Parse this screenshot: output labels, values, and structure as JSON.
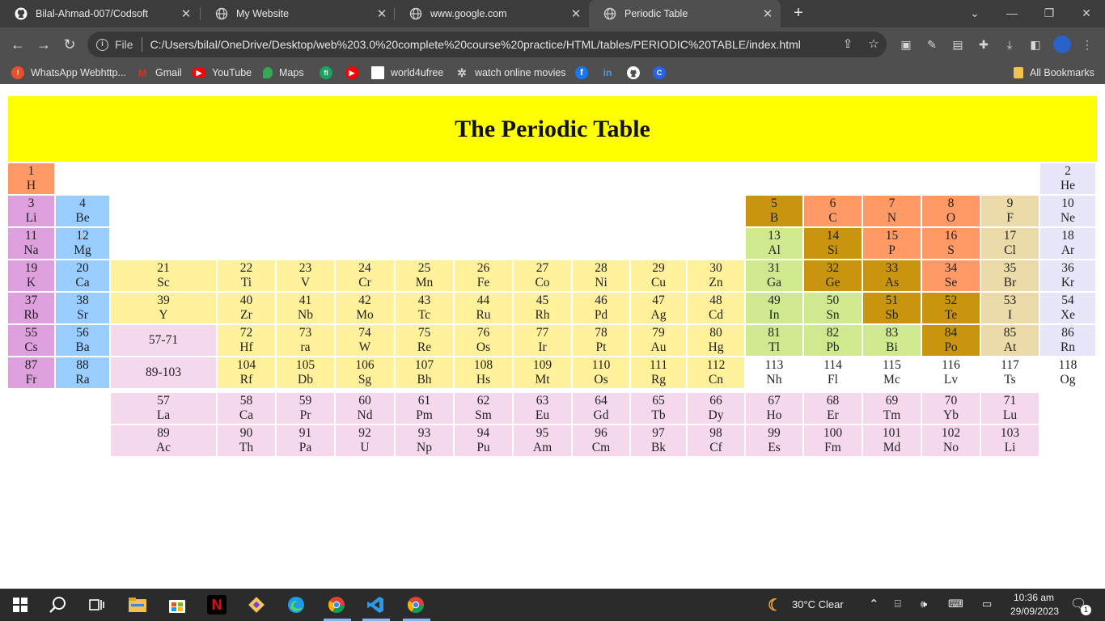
{
  "browser": {
    "tabs": [
      {
        "label": "Bilal-Ahmad-007/Codsoft",
        "icon": "github-icon",
        "active": false
      },
      {
        "label": "My Website",
        "icon": "globe-icon",
        "active": false
      },
      {
        "label": "www.google.com",
        "icon": "globe-icon",
        "active": false
      },
      {
        "label": "Periodic Table",
        "icon": "globe-icon",
        "active": true
      }
    ],
    "new_tab_label": "+",
    "address_scheme": "File",
    "url": "C:/Users/bilal/OneDrive/Desktop/web%203.0%20complete%20course%20practice/HTML/tables/PERIODIC%20TABLE/index.html",
    "bookmarks": [
      {
        "label": "WhatsApp Webhttp...",
        "icon": "whatsapp-icon",
        "color": "#e8502b"
      },
      {
        "label": "Gmail",
        "icon": "gmail-icon",
        "color": "#d93025"
      },
      {
        "label": "YouTube",
        "icon": "youtube-icon",
        "color": "#ff0000"
      },
      {
        "label": "Maps",
        "icon": "maps-icon",
        "color": "#34a853"
      },
      {
        "label": "",
        "icon": "fi-icon",
        "color": "#1aa260"
      },
      {
        "label": "",
        "icon": "red-play-icon",
        "color": "#ff0000"
      },
      {
        "label": "world4ufree",
        "icon": "page-icon",
        "color": "#ffffff"
      },
      {
        "label": "watch online movies",
        "icon": "film-icon",
        "color": "#888888"
      },
      {
        "label": "",
        "icon": "facebook-icon",
        "color": "#1877f2"
      },
      {
        "label": "",
        "icon": "linkedin-icon",
        "color": "#0a66c2"
      },
      {
        "label": "",
        "icon": "github-icon",
        "color": "#ffffff"
      },
      {
        "label": "",
        "icon": "c-logo-icon",
        "color": "#2563eb"
      }
    ],
    "all_bookmarks_label": "All Bookmarks"
  },
  "page": {
    "title": "The Periodic Table",
    "colors": {
      "title_bg": "#ffff00",
      "alkali": "#dda0dd",
      "alkaline_earth": "#99ccff",
      "transition": "#fff09a",
      "f_block": "#f5d8ec",
      "poor_metal": "#cfe98f",
      "metalloid": "#c9940f",
      "nonmetal": "#ff9966",
      "halogen": "#ecdaa8",
      "noble_gas": "#e6e6f8",
      "unknown": "#ffffff"
    },
    "rows": [
      [
        {
          "num": "1",
          "sym": "H",
          "type": "nonmetal",
          "col": 0
        }
      ],
      [
        {
          "num": "3",
          "sym": "Li",
          "type": "alkali",
          "col": 0
        },
        {
          "num": "4",
          "sym": "Be",
          "type": "alkaline_earth",
          "col": 1
        }
      ],
      [
        {
          "num": "11",
          "sym": "Na",
          "type": "alkali",
          "col": 0
        },
        {
          "num": "12",
          "sym": "Mg",
          "type": "alkaline_earth",
          "col": 1
        }
      ],
      [
        {
          "num": "19",
          "sym": "K",
          "type": "alkali",
          "col": 0
        },
        {
          "num": "20",
          "sym": "Ca",
          "type": "alkaline_earth",
          "col": 1
        },
        {
          "num": "21",
          "sym": "Sc",
          "type": "transition",
          "col": 2
        },
        {
          "num": "22",
          "sym": "Ti",
          "type": "transition",
          "col": 3
        },
        {
          "num": "23",
          "sym": "V",
          "type": "transition",
          "col": 4
        },
        {
          "num": "24",
          "sym": "Cr",
          "type": "transition",
          "col": 5
        },
        {
          "num": "25",
          "sym": "Mn",
          "type": "transition",
          "col": 6
        },
        {
          "num": "26",
          "sym": "Fe",
          "type": "transition",
          "col": 7
        },
        {
          "num": "27",
          "sym": "Co",
          "type": "transition",
          "col": 8
        },
        {
          "num": "28",
          "sym": "Ni",
          "type": "transition",
          "col": 9
        },
        {
          "num": "29",
          "sym": "Cu",
          "type": "transition",
          "col": 10
        },
        {
          "num": "30",
          "sym": "Zn",
          "type": "transition",
          "col": 11
        },
        {
          "num": "31",
          "sym": "Ga",
          "type": "poor_metal",
          "col": 12
        },
        {
          "num": "32",
          "sym": "Ge",
          "type": "metalloid",
          "col": 13
        },
        {
          "num": "33",
          "sym": "As",
          "type": "metalloid",
          "col": 14
        },
        {
          "num": "34",
          "sym": "Se",
          "type": "nonmetal",
          "col": 15
        },
        {
          "num": "35",
          "sym": "Br",
          "type": "halogen",
          "col": 16
        },
        {
          "num": "36",
          "sym": "Kr",
          "type": "noble_gas",
          "col": 17
        }
      ],
      [
        {
          "num": "37",
          "sym": "Rb",
          "type": "alkali",
          "col": 0
        },
        {
          "num": "38",
          "sym": "Sr",
          "type": "alkaline_earth",
          "col": 1
        },
        {
          "num": "39",
          "sym": "Y",
          "type": "transition",
          "col": 2
        },
        {
          "num": "40",
          "sym": "Zr",
          "type": "transition",
          "col": 3
        },
        {
          "num": "41",
          "sym": "Nb",
          "type": "transition",
          "col": 4
        },
        {
          "num": "42",
          "sym": "Mo",
          "type": "transition",
          "col": 5
        },
        {
          "num": "43",
          "sym": "Tc",
          "type": "transition",
          "col": 6
        },
        {
          "num": "44",
          "sym": "Ru",
          "type": "transition",
          "col": 7
        },
        {
          "num": "45",
          "sym": "Rh",
          "type": "transition",
          "col": 8
        },
        {
          "num": "46",
          "sym": "Pd",
          "type": "transition",
          "col": 9
        },
        {
          "num": "47",
          "sym": "Ag",
          "type": "transition",
          "col": 10
        },
        {
          "num": "48",
          "sym": "Cd",
          "type": "transition",
          "col": 11
        },
        {
          "num": "49",
          "sym": "In",
          "type": "poor_metal",
          "col": 12
        },
        {
          "num": "50",
          "sym": "Sn",
          "type": "poor_metal",
          "col": 13
        },
        {
          "num": "51",
          "sym": "Sb",
          "type": "metalloid",
          "col": 14
        },
        {
          "num": "52",
          "sym": "Te",
          "type": "metalloid",
          "col": 15
        },
        {
          "num": "53",
          "sym": "I",
          "type": "halogen",
          "col": 16
        },
        {
          "num": "54",
          "sym": "Xe",
          "type": "noble_gas",
          "col": 17
        }
      ],
      [
        {
          "num": "55",
          "sym": "Cs",
          "type": "alkali",
          "col": 0
        },
        {
          "num": "56",
          "sym": "Ba",
          "type": "alkaline_earth",
          "col": 1
        },
        {
          "num": "57-71",
          "sym": "",
          "type": "f_block",
          "col": 2
        },
        {
          "num": "72",
          "sym": "Hf",
          "type": "transition",
          "col": 3
        },
        {
          "num": "73",
          "sym": "ra",
          "type": "transition",
          "col": 4
        },
        {
          "num": "74",
          "sym": "W",
          "type": "transition",
          "col": 5
        },
        {
          "num": "75",
          "sym": "Re",
          "type": "transition",
          "col": 6
        },
        {
          "num": "76",
          "sym": "Os",
          "type": "transition",
          "col": 7
        },
        {
          "num": "77",
          "sym": "Ir",
          "type": "transition",
          "col": 8
        },
        {
          "num": "78",
          "sym": "Pt",
          "type": "transition",
          "col": 9
        },
        {
          "num": "79",
          "sym": "Au",
          "type": "transition",
          "col": 10
        },
        {
          "num": "80",
          "sym": "Hg",
          "type": "transition",
          "col": 11
        },
        {
          "num": "81",
          "sym": "Tl",
          "type": "poor_metal",
          "col": 12
        },
        {
          "num": "82",
          "sym": "Pb",
          "type": "poor_metal",
          "col": 13
        },
        {
          "num": "83",
          "sym": "Bi",
          "type": "poor_metal",
          "col": 14
        },
        {
          "num": "84",
          "sym": "Po",
          "type": "metalloid",
          "col": 15
        },
        {
          "num": "85",
          "sym": "At",
          "type": "halogen",
          "col": 16
        },
        {
          "num": "86",
          "sym": "Rn",
          "type": "noble_gas",
          "col": 17
        }
      ],
      [
        {
          "num": "87",
          "sym": "Fr",
          "type": "alkali",
          "col": 0
        },
        {
          "num": "88",
          "sym": "Ra",
          "type": "alkaline_earth",
          "col": 1
        },
        {
          "num": "89-103",
          "sym": "",
          "type": "f_block",
          "col": 2
        },
        {
          "num": "104",
          "sym": "Rf",
          "type": "transition",
          "col": 3
        },
        {
          "num": "105",
          "sym": "Db",
          "type": "transition",
          "col": 4
        },
        {
          "num": "106",
          "sym": "Sg",
          "type": "transition",
          "col": 5
        },
        {
          "num": "107",
          "sym": "Bh",
          "type": "transition",
          "col": 6
        },
        {
          "num": "108",
          "sym": "Hs",
          "type": "transition",
          "col": 7
        },
        {
          "num": "109",
          "sym": "Mt",
          "type": "transition",
          "col": 8
        },
        {
          "num": "110",
          "sym": "Os",
          "type": "transition",
          "col": 9
        },
        {
          "num": "111",
          "sym": "Rg",
          "type": "transition",
          "col": 10
        },
        {
          "num": "112",
          "sym": "Cn",
          "type": "transition",
          "col": 11
        },
        {
          "num": "113",
          "sym": "Nh",
          "type": "unknown",
          "col": 12
        },
        {
          "num": "114",
          "sym": "Fl",
          "type": "unknown",
          "col": 13
        },
        {
          "num": "115",
          "sym": "Mc",
          "type": "unknown",
          "col": 14
        },
        {
          "num": "116",
          "sym": "Lv",
          "type": "unknown",
          "col": 15
        },
        {
          "num": "117",
          "sym": "Ts",
          "type": "unknown",
          "col": 16
        },
        {
          "num": "118",
          "sym": "Og",
          "type": "unknown",
          "col": 17
        }
      ]
    ],
    "extra_row1": [
      {
        "num": "2",
        "sym": "He",
        "type": "noble_gas",
        "col": 17
      }
    ],
    "extra_row2": [
      {
        "num": "5",
        "sym": "B",
        "type": "metalloid",
        "col": 12
      },
      {
        "num": "6",
        "sym": "C",
        "type": "nonmetal",
        "col": 13
      },
      {
        "num": "7",
        "sym": "N",
        "type": "nonmetal",
        "col": 14
      },
      {
        "num": "8",
        "sym": "O",
        "type": "nonmetal",
        "col": 15
      },
      {
        "num": "9",
        "sym": "F",
        "type": "halogen",
        "col": 16
      },
      {
        "num": "10",
        "sym": "Ne",
        "type": "noble_gas",
        "col": 17
      }
    ],
    "extra_row3": [
      {
        "num": "13",
        "sym": "Al",
        "type": "poor_metal",
        "col": 12
      },
      {
        "num": "14",
        "sym": "Si",
        "type": "metalloid",
        "col": 13
      },
      {
        "num": "15",
        "sym": "P",
        "type": "nonmetal",
        "col": 14
      },
      {
        "num": "16",
        "sym": "S",
        "type": "nonmetal",
        "col": 15
      },
      {
        "num": "17",
        "sym": "Cl",
        "type": "halogen",
        "col": 16
      },
      {
        "num": "18",
        "sym": "Ar",
        "type": "noble_gas",
        "col": 17
      }
    ],
    "lanthanides": [
      {
        "num": "57",
        "sym": "La"
      },
      {
        "num": "58",
        "sym": "Ca"
      },
      {
        "num": "59",
        "sym": "Pr"
      },
      {
        "num": "60",
        "sym": "Nd"
      },
      {
        "num": "61",
        "sym": "Pm"
      },
      {
        "num": "62",
        "sym": "Sm"
      },
      {
        "num": "63",
        "sym": "Eu"
      },
      {
        "num": "64",
        "sym": "Gd"
      },
      {
        "num": "65",
        "sym": "Tb"
      },
      {
        "num": "66",
        "sym": "Dy"
      },
      {
        "num": "67",
        "sym": "Ho"
      },
      {
        "num": "68",
        "sym": "Er"
      },
      {
        "num": "69",
        "sym": "Tm"
      },
      {
        "num": "70",
        "sym": "Yb"
      },
      {
        "num": "71",
        "sym": "Lu"
      }
    ],
    "actinides": [
      {
        "num": "89",
        "sym": "Ac"
      },
      {
        "num": "90",
        "sym": "Th"
      },
      {
        "num": "91",
        "sym": "Pa"
      },
      {
        "num": "92",
        "sym": "U"
      },
      {
        "num": "93",
        "sym": "Np"
      },
      {
        "num": "94",
        "sym": "Pu"
      },
      {
        "num": "95",
        "sym": "Am"
      },
      {
        "num": "96",
        "sym": "Cm"
      },
      {
        "num": "97",
        "sym": "Bk"
      },
      {
        "num": "98",
        "sym": "Cf"
      },
      {
        "num": "99",
        "sym": "Es"
      },
      {
        "num": "100",
        "sym": "Fm"
      },
      {
        "num": "101",
        "sym": "Md"
      },
      {
        "num": "102",
        "sym": "No"
      },
      {
        "num": "103",
        "sym": "Li"
      }
    ]
  },
  "taskbar": {
    "weather": "30°C  Clear",
    "time": "10:36 am",
    "date": "29/09/2023",
    "notification_count": "1"
  }
}
